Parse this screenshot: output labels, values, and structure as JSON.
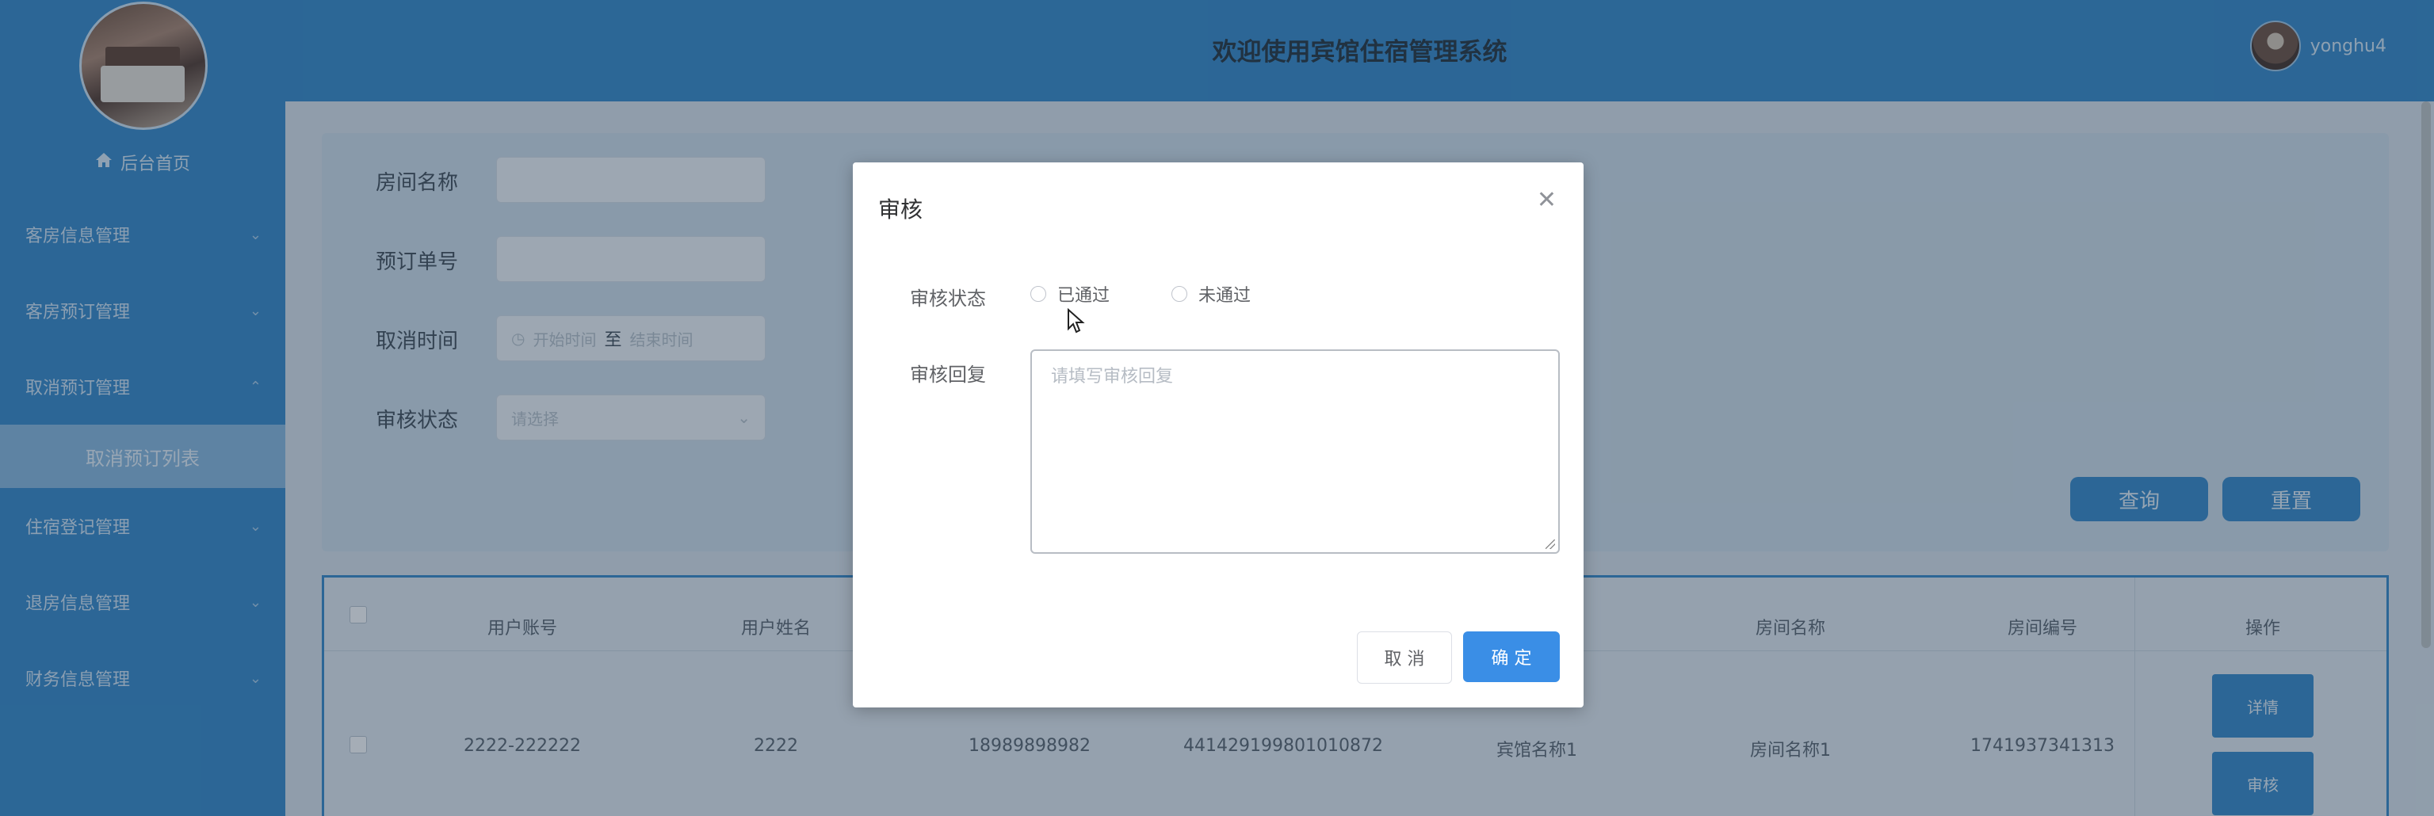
{
  "header": {
    "title": "欢迎使用宾馆住宿管理系统",
    "username": "yonghu4"
  },
  "sidebar": {
    "home": "后台首页",
    "items": [
      {
        "label": "客房信息管理"
      },
      {
        "label": "客房预订管理"
      },
      {
        "label": "取消预订管理"
      },
      {
        "label": "住宿登记管理"
      },
      {
        "label": "退房信息管理"
      },
      {
        "label": "财务信息管理"
      }
    ],
    "active_sub": "取消预订列表"
  },
  "search": {
    "room_name_label": "房间名称",
    "order_no_label": "预订单号",
    "cancel_time_label": "取消时间",
    "start_placeholder": "开始时间",
    "range_sep": "至",
    "end_placeholder": "结束时间",
    "audit_status_label": "审核状态",
    "audit_status_placeholder": "请选择",
    "query_button": "查询",
    "reset_button": "重置"
  },
  "table": {
    "headers": {
      "user_account": "用户账号",
      "user_name": "用户姓名",
      "room_name": "房间名称",
      "room_no": "房间编号",
      "actions": "操作"
    },
    "row": {
      "user_account": "2222-222222",
      "user_name": "2222",
      "phone": "18989898982",
      "id_card": "441429199801010872",
      "hotel_name": "宾馆名称1",
      "room_name": "房间名称1",
      "room_no": "1741937341313",
      "detail_button": "详情",
      "audit_button": "审核"
    }
  },
  "dialog": {
    "title": "审核",
    "status_label": "审核状态",
    "option_passed": "已通过",
    "option_failed": "未通过",
    "reply_label": "审核回复",
    "reply_placeholder": "请填写审核回复",
    "cancel_button": "取 消",
    "confirm_button": "确 定"
  },
  "icons": {
    "home": "home-icon",
    "chevron": "chevron-down-icon",
    "close": "close-icon",
    "clock": "clock-icon",
    "cursor": "mouse-cursor-icon"
  },
  "colors": {
    "primary": "#2f86c9",
    "confirm": "#3a8ee6"
  }
}
